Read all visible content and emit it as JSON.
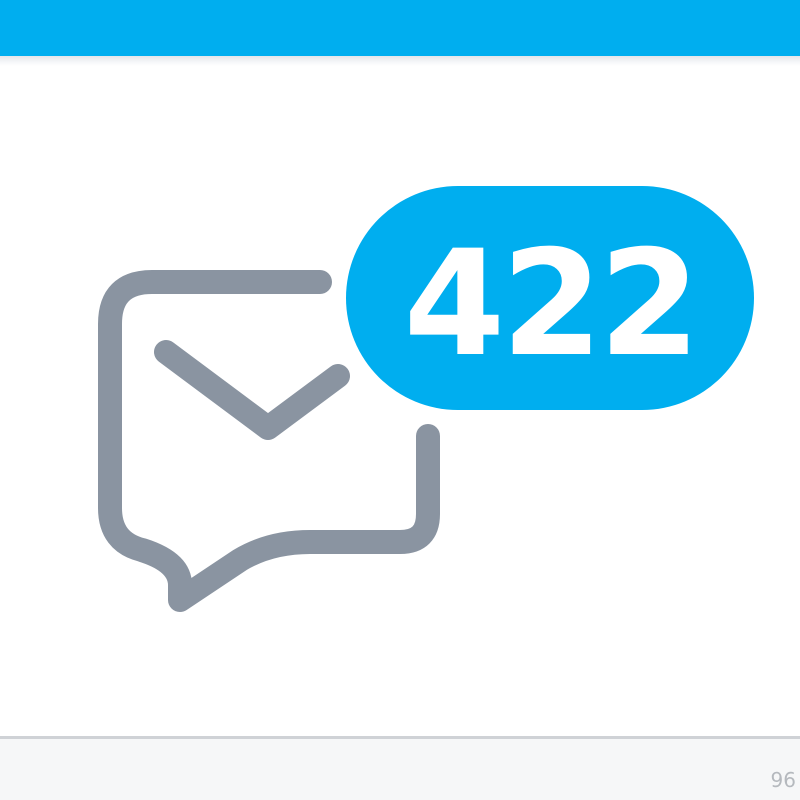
{
  "colors": {
    "accent": "#00aeef",
    "icon": "#8a94a1",
    "badge_text": "#ffffff"
  },
  "icons": {
    "message": "envelope-chat-bubble-icon"
  },
  "notification": {
    "count": "422"
  },
  "footer": {
    "corner_text": "96"
  }
}
